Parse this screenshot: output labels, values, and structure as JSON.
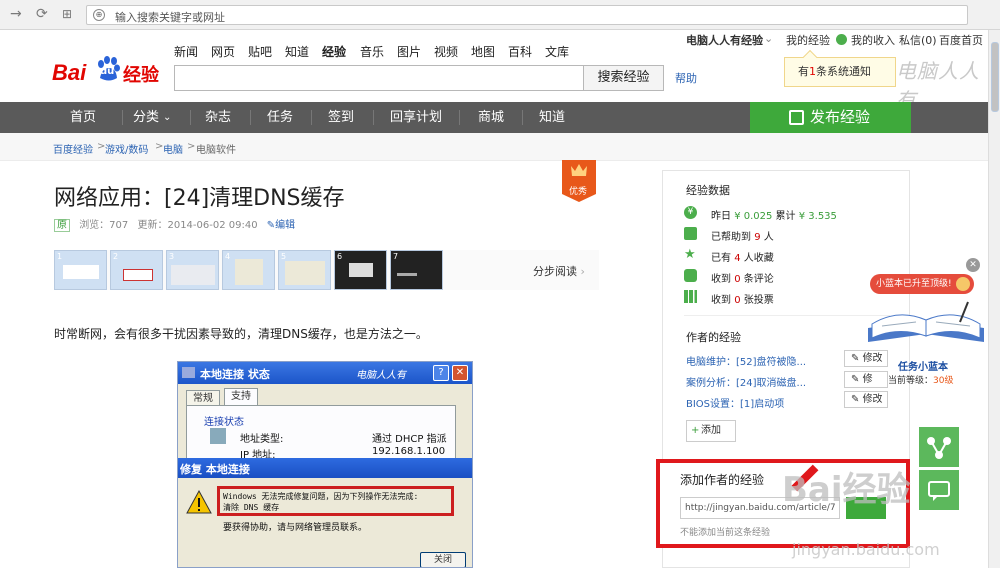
{
  "browser": {
    "address_placeholder": "输入搜索关键字或网址"
  },
  "userbar": {
    "username": "电脑人人有经验",
    "my_exp": "我的经验",
    "income": "我的收入",
    "message": "私信(0)",
    "home": "百度首页"
  },
  "logo": {
    "bai": "Bai",
    "du": "du",
    "jingyan": "经验"
  },
  "topnav": [
    "新闻",
    "网页",
    "贴吧",
    "知道",
    "经验",
    "音乐",
    "图片",
    "视频",
    "地图",
    "百科",
    "文库"
  ],
  "search": {
    "button": "搜索经验",
    "help": "帮助"
  },
  "notify": {
    "pre": "有",
    "count": "1",
    "post": "条系统通知"
  },
  "watermark_top": "电脑人人有",
  "mainnav": [
    "首页",
    "分类",
    "杂志",
    "任务",
    "签到",
    "回享计划",
    "商城",
    "知道"
  ],
  "publish": "发布经验",
  "breadcrumb": [
    "百度经验",
    ">",
    "游戏/数码",
    ">",
    "电脑",
    ">",
    "电脑软件"
  ],
  "article": {
    "title": "网络应用：[24]清理DNS缓存",
    "badge": "优秀",
    "original": "原",
    "views": "浏览：707",
    "updated": "更新：2014-06-02 09:40",
    "edit": "编辑",
    "step_numbers": [
      "1",
      "2",
      "3",
      "4",
      "5",
      "6",
      "7"
    ],
    "step_read": "分步阅读",
    "intro": "时常断网，会有很多干扰因素导致的，清理DNS缓存，也是方法之一。"
  },
  "dialog": {
    "title": "本地连接 状态",
    "watermark": "电脑人人有",
    "tabs": [
      "常规",
      "支持"
    ],
    "group": "连接状态",
    "addr_type_label": "地址类型:",
    "addr_type_value": "通过 DHCP 指派",
    "ip_label": "IP 地址:",
    "ip_value": "192.168.1.100",
    "repair_title": "修复 本地连接",
    "error_line1": "Windows 无法完成修复问题，因为下列操作无法完成:",
    "error_line2": "清除 DNS 缓存",
    "help_text": "要获得协助，请与网络管理员联系。",
    "close": "关闭"
  },
  "sidebar": {
    "stats_title": "经验数据",
    "yesterday_label": "昨日",
    "yesterday_value": "¥ 0.025",
    "total_label": "累计",
    "total_value": "¥ 3.535",
    "helped_pre": "已帮助到",
    "helped_count": "9",
    "helped_post": "人",
    "fav_pre": "已有",
    "fav_count": "4",
    "fav_post": "人收藏",
    "cmt_pre": "收到",
    "cmt_count": "0",
    "cmt_post": "条评论",
    "vote_pre": "收到",
    "vote_count": "0",
    "vote_post": "张投票",
    "author_title": "作者的经验",
    "exp_items": [
      "电脑维护：[52]盘符被隐...",
      "案例分析：[24]取消磁盘...",
      "BIOS设置：[1]启动项"
    ],
    "edit_labels": [
      "修改",
      "修",
      "修改"
    ],
    "add": "添加"
  },
  "addbox": {
    "title": "添加作者的经验",
    "input": "http://jingyan.baidu.com/article/7",
    "tip": "不能添加当前这条经验"
  },
  "watermark": {
    "big": "Bai经验",
    "url": "jingyan.baidu.com"
  },
  "float": {
    "bubble": "小蓝本已升至顶级!",
    "title": "任务小蓝本",
    "level_label": "当前等级：",
    "level_value": "30级"
  },
  "colors": {
    "accent": "#3ea93b",
    "brand": "#e10602",
    "nav": "#5a5a5a",
    "link": "#2d64b3"
  }
}
